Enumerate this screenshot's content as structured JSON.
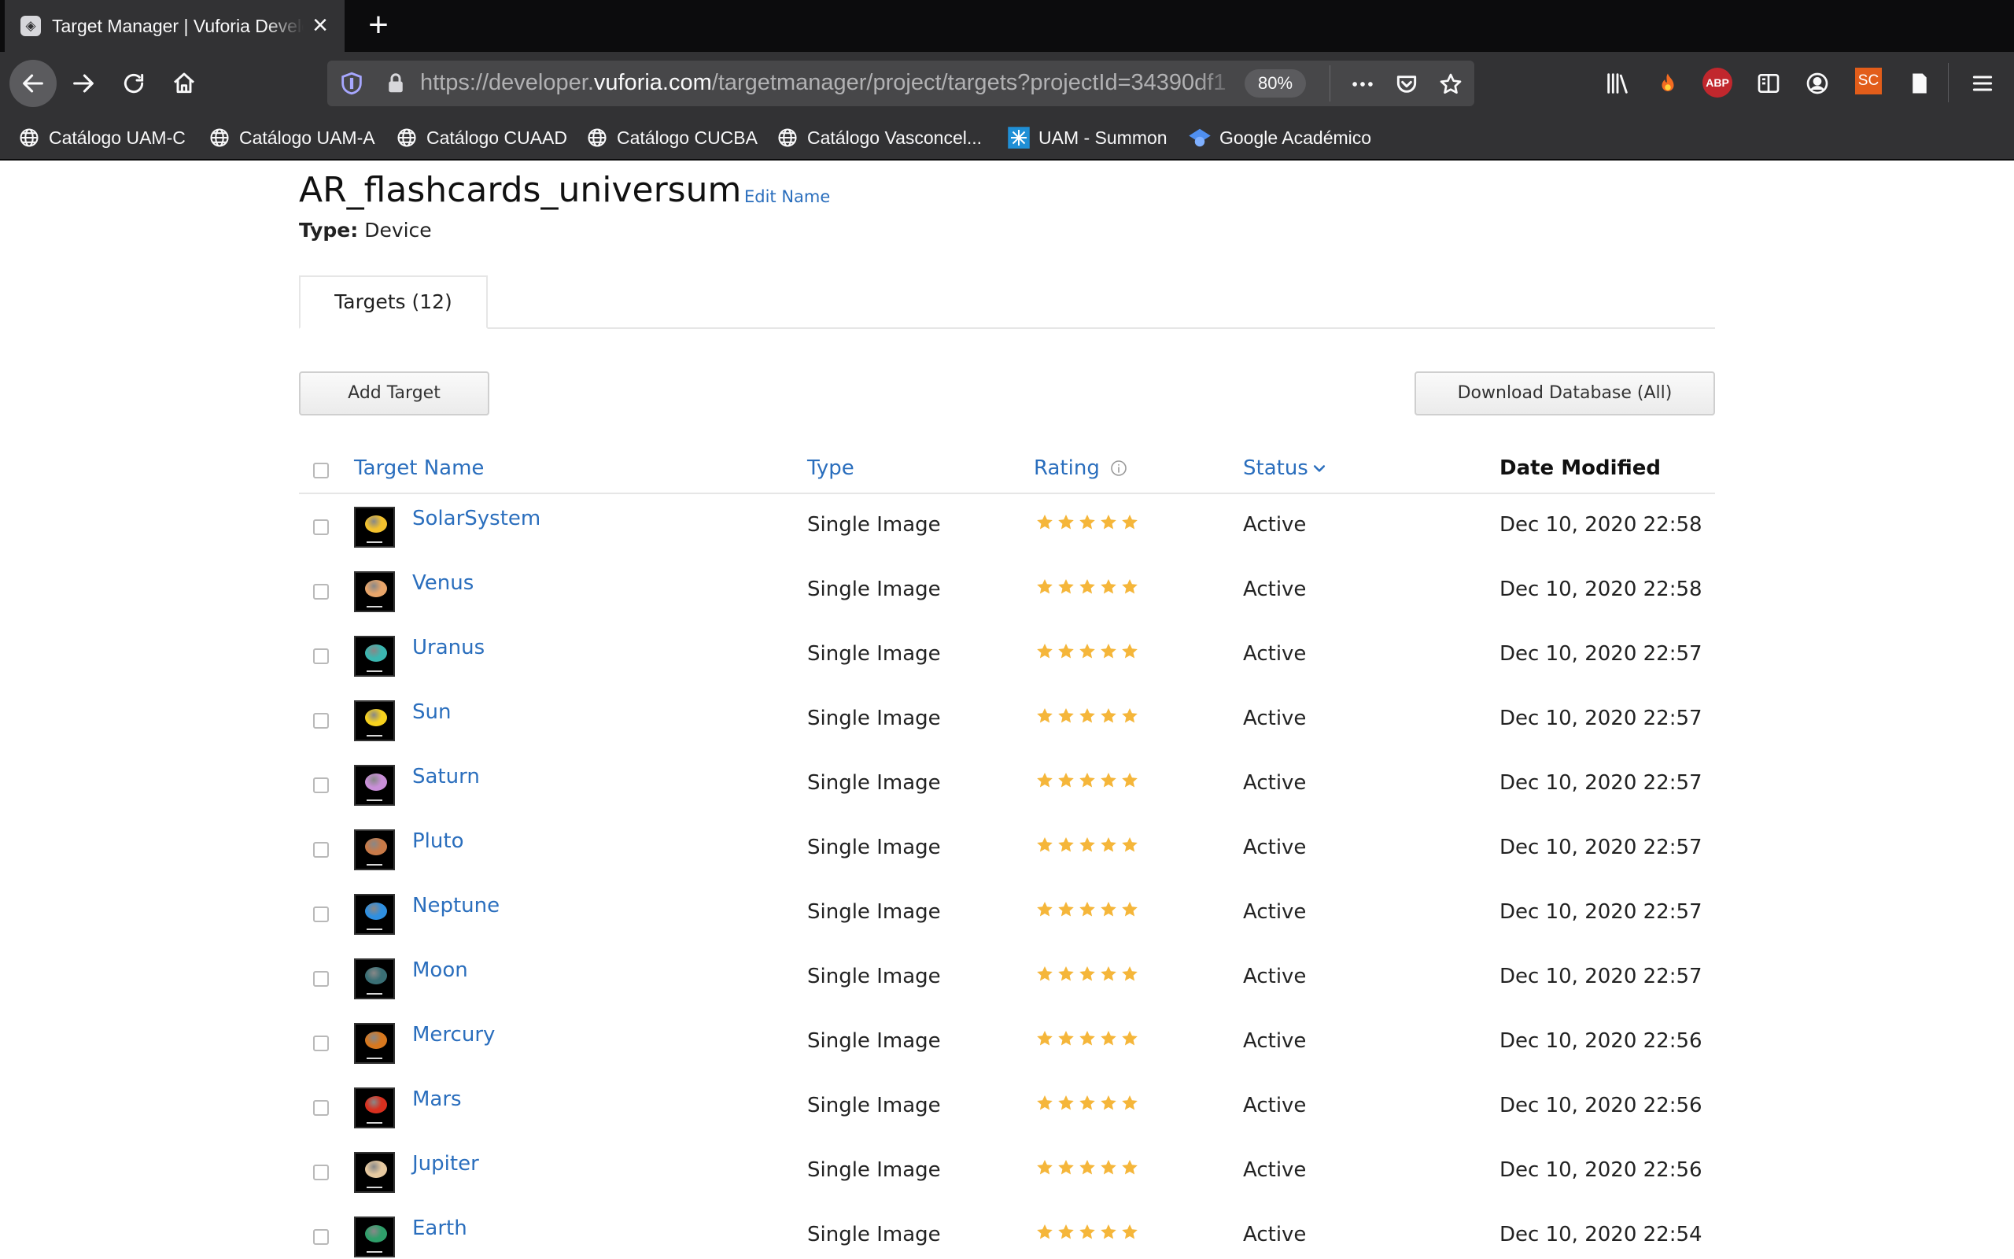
{
  "browser": {
    "tab_title": "Target Manager | Vuforia Developer Portal",
    "url_prefix": "https://developer.",
    "url_host": "vuforia.com",
    "url_path": "/targetmanager/project/targets?projectId=34390df1",
    "zoom": "80%",
    "bookmarks": [
      {
        "label": "Catálogo UAM-C",
        "icon": "globe-icon"
      },
      {
        "label": "Catálogo UAM-A",
        "icon": "globe-icon"
      },
      {
        "label": "Catálogo CUAAD",
        "icon": "globe-icon"
      },
      {
        "label": "Catálogo CUCBA",
        "icon": "globe-icon"
      },
      {
        "label": "Catálogo Vasconcel...",
        "icon": "globe-icon"
      },
      {
        "label": "UAM - Summon",
        "icon": "summon-icon"
      },
      {
        "label": "Google Académico",
        "icon": "scholar-icon"
      }
    ],
    "toolbar_icons": [
      "library-icon",
      "fire-icon",
      "adblock-icon",
      "reader-icon",
      "account-icon",
      "sc-icon",
      "notes-icon",
      "menu-icon"
    ],
    "abp_label": "ABP",
    "sc_label": "SC"
  },
  "page": {
    "title": "AR_flashcards_universum",
    "edit_name": "Edit Name",
    "type_label": "Type:",
    "type_value": "Device",
    "tab_label": "Targets (12)",
    "add_button": "Add Target",
    "download_button": "Download Database (All)"
  },
  "table": {
    "headers": {
      "name": "Target Name",
      "type": "Type",
      "rating": "Rating",
      "status": "Status",
      "date": "Date Modified"
    },
    "rows": [
      {
        "name": "SolarSystem",
        "type": "Single Image",
        "rating": 5,
        "status": "Active",
        "date": "Dec 10, 2020 22:58",
        "color": "#f2c12e"
      },
      {
        "name": "Venus",
        "type": "Single Image",
        "rating": 5,
        "status": "Active",
        "date": "Dec 10, 2020 22:58",
        "color": "#e8a56a"
      },
      {
        "name": "Uranus",
        "type": "Single Image",
        "rating": 5,
        "status": "Active",
        "date": "Dec 10, 2020 22:57",
        "color": "#3bb6b0"
      },
      {
        "name": "Sun",
        "type": "Single Image",
        "rating": 5,
        "status": "Active",
        "date": "Dec 10, 2020 22:57",
        "color": "#f7d21e"
      },
      {
        "name": "Saturn",
        "type": "Single Image",
        "rating": 5,
        "status": "Active",
        "date": "Dec 10, 2020 22:57",
        "color": "#c98fd8"
      },
      {
        "name": "Pluto",
        "type": "Single Image",
        "rating": 5,
        "status": "Active",
        "date": "Dec 10, 2020 22:57",
        "color": "#c87a48"
      },
      {
        "name": "Neptune",
        "type": "Single Image",
        "rating": 5,
        "status": "Active",
        "date": "Dec 10, 2020 22:57",
        "color": "#2f8fe0"
      },
      {
        "name": "Moon",
        "type": "Single Image",
        "rating": 5,
        "status": "Active",
        "date": "Dec 10, 2020 22:57",
        "color": "#3a6f75"
      },
      {
        "name": "Mercury",
        "type": "Single Image",
        "rating": 5,
        "status": "Active",
        "date": "Dec 10, 2020 22:56",
        "color": "#d7781f"
      },
      {
        "name": "Mars",
        "type": "Single Image",
        "rating": 5,
        "status": "Active",
        "date": "Dec 10, 2020 22:56",
        "color": "#d9301f"
      },
      {
        "name": "Jupiter",
        "type": "Single Image",
        "rating": 5,
        "status": "Active",
        "date": "Dec 10, 2020 22:56",
        "color": "#e6c9a0"
      },
      {
        "name": "Earth",
        "type": "Single Image",
        "rating": 5,
        "status": "Active",
        "date": "Dec 10, 2020 22:54",
        "color": "#2f9f6a"
      }
    ]
  },
  "colors": {
    "link": "#2a6ebd",
    "star": "#f5b63a",
    "chrome_dark": "#0c0c0d",
    "chrome": "#323234"
  }
}
